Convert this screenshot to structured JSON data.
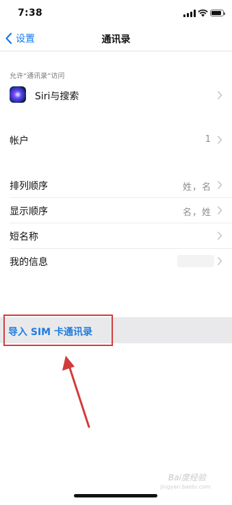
{
  "status_bar": {
    "time": "7:38",
    "battery_level": 0.85
  },
  "nav": {
    "back_label": "设置",
    "title": "通讯录"
  },
  "section_header": "允许“通讯录”访问",
  "rows": [
    {
      "label": "Siri与搜索",
      "value": ""
    },
    {
      "label": "帐户",
      "value": "1"
    },
    {
      "label": "排列顺序",
      "value": "姓，名"
    },
    {
      "label": "显示顺序",
      "value": "名，姓"
    },
    {
      "label": "短名称",
      "value": ""
    },
    {
      "label": "我的信息",
      "value": ""
    }
  ],
  "import_label": "导入 SIM 卡通讯录",
  "watermark": {
    "brand": "Bai度经验",
    "url": "jingyan.baidu.com"
  },
  "colors": {
    "accent": "#1478f0",
    "annotation": "#d23b3b"
  },
  "icons": [
    "signal-icon",
    "wifi-icon",
    "battery-icon",
    "back-chevron-icon",
    "siri-icon",
    "chevron-right-icon"
  ]
}
